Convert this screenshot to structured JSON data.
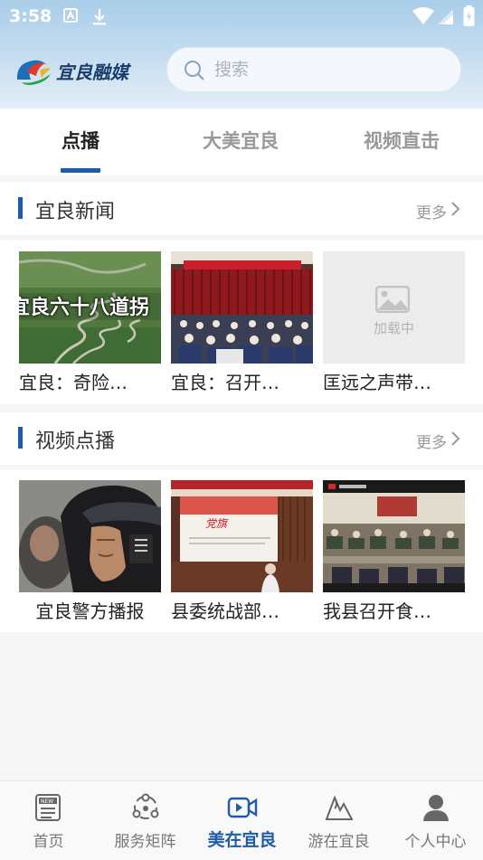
{
  "status_bar": {
    "time": "3:58"
  },
  "header": {
    "search_placeholder": "搜索"
  },
  "tabs": [
    {
      "label": "点播",
      "active": true
    },
    {
      "label": "大美宜良",
      "active": false
    },
    {
      "label": "视频直击",
      "active": false
    }
  ],
  "sections": [
    {
      "title": "宜良新闻",
      "more": "更多",
      "items": [
        {
          "caption": "宜良：奇险…",
          "thumb_text": "宜良六十八道拐"
        },
        {
          "caption": "宜良：召开…"
        },
        {
          "caption": "匡远之声带…",
          "loading_text": "加载中"
        }
      ]
    },
    {
      "title": "视频点播",
      "more": "更多",
      "items": [
        {
          "caption": "宜良警方播报"
        },
        {
          "caption": "县委统战部…"
        },
        {
          "caption": "我县召开食…"
        }
      ]
    }
  ],
  "bottom_nav": [
    {
      "label": "首页",
      "icon": "news-icon",
      "active": false
    },
    {
      "label": "服务矩阵",
      "icon": "network-icon",
      "active": false
    },
    {
      "label": "美在宜良",
      "icon": "video-icon",
      "active": true
    },
    {
      "label": "游在宜良",
      "icon": "mountain-icon",
      "active": false
    },
    {
      "label": "个人中心",
      "icon": "user-icon",
      "active": false
    }
  ],
  "colors": {
    "accent": "#1f5ba8",
    "header_bg": "#b9d6ec"
  }
}
